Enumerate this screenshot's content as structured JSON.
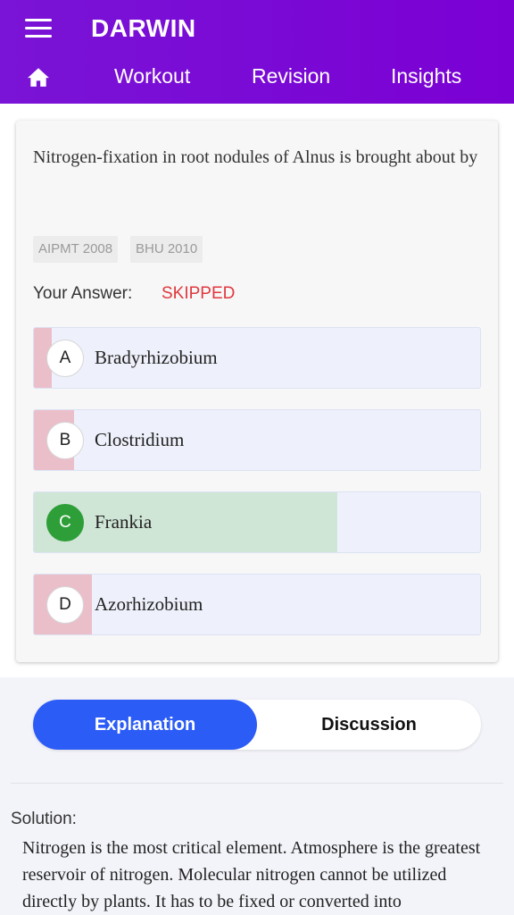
{
  "header": {
    "brand": "DARWIN",
    "nav": [
      "Workout",
      "Revision",
      "Insights"
    ]
  },
  "question": {
    "text": "Nitrogen-fixation in root nodules of Alnus is brought about by",
    "tags": [
      "AIPMT 2008",
      "BHU 2010"
    ],
    "answer_label": "Your Answer:",
    "answer_value": "SKIPPED"
  },
  "options": [
    {
      "letter": "A",
      "text": "Bradyrhizobium",
      "share": 0.04,
      "correct": false
    },
    {
      "letter": "B",
      "text": "Clostridium",
      "share": 0.09,
      "correct": false
    },
    {
      "letter": "C",
      "text": "Frankia",
      "share": 0.68,
      "correct": true
    },
    {
      "letter": "D",
      "text": "Azorhizobium",
      "share": 0.13,
      "correct": false
    }
  ],
  "colors": {
    "header": "#7b00d4",
    "wrong_fill": "#eabfca",
    "correct_fill": "#cfe5d6",
    "skipped": "#e0383f",
    "active_tab": "#2c5cf6"
  },
  "tabs": {
    "explanation": "Explanation",
    "discussion": "Discussion"
  },
  "solution": {
    "title": "Solution:",
    "text": "Nitrogen is the most critical element. Atmosphere is the greatest reservoir of nitrogen. Molecular nitrogen cannot be utilized directly by plants. It has to be fixed or converted into"
  }
}
